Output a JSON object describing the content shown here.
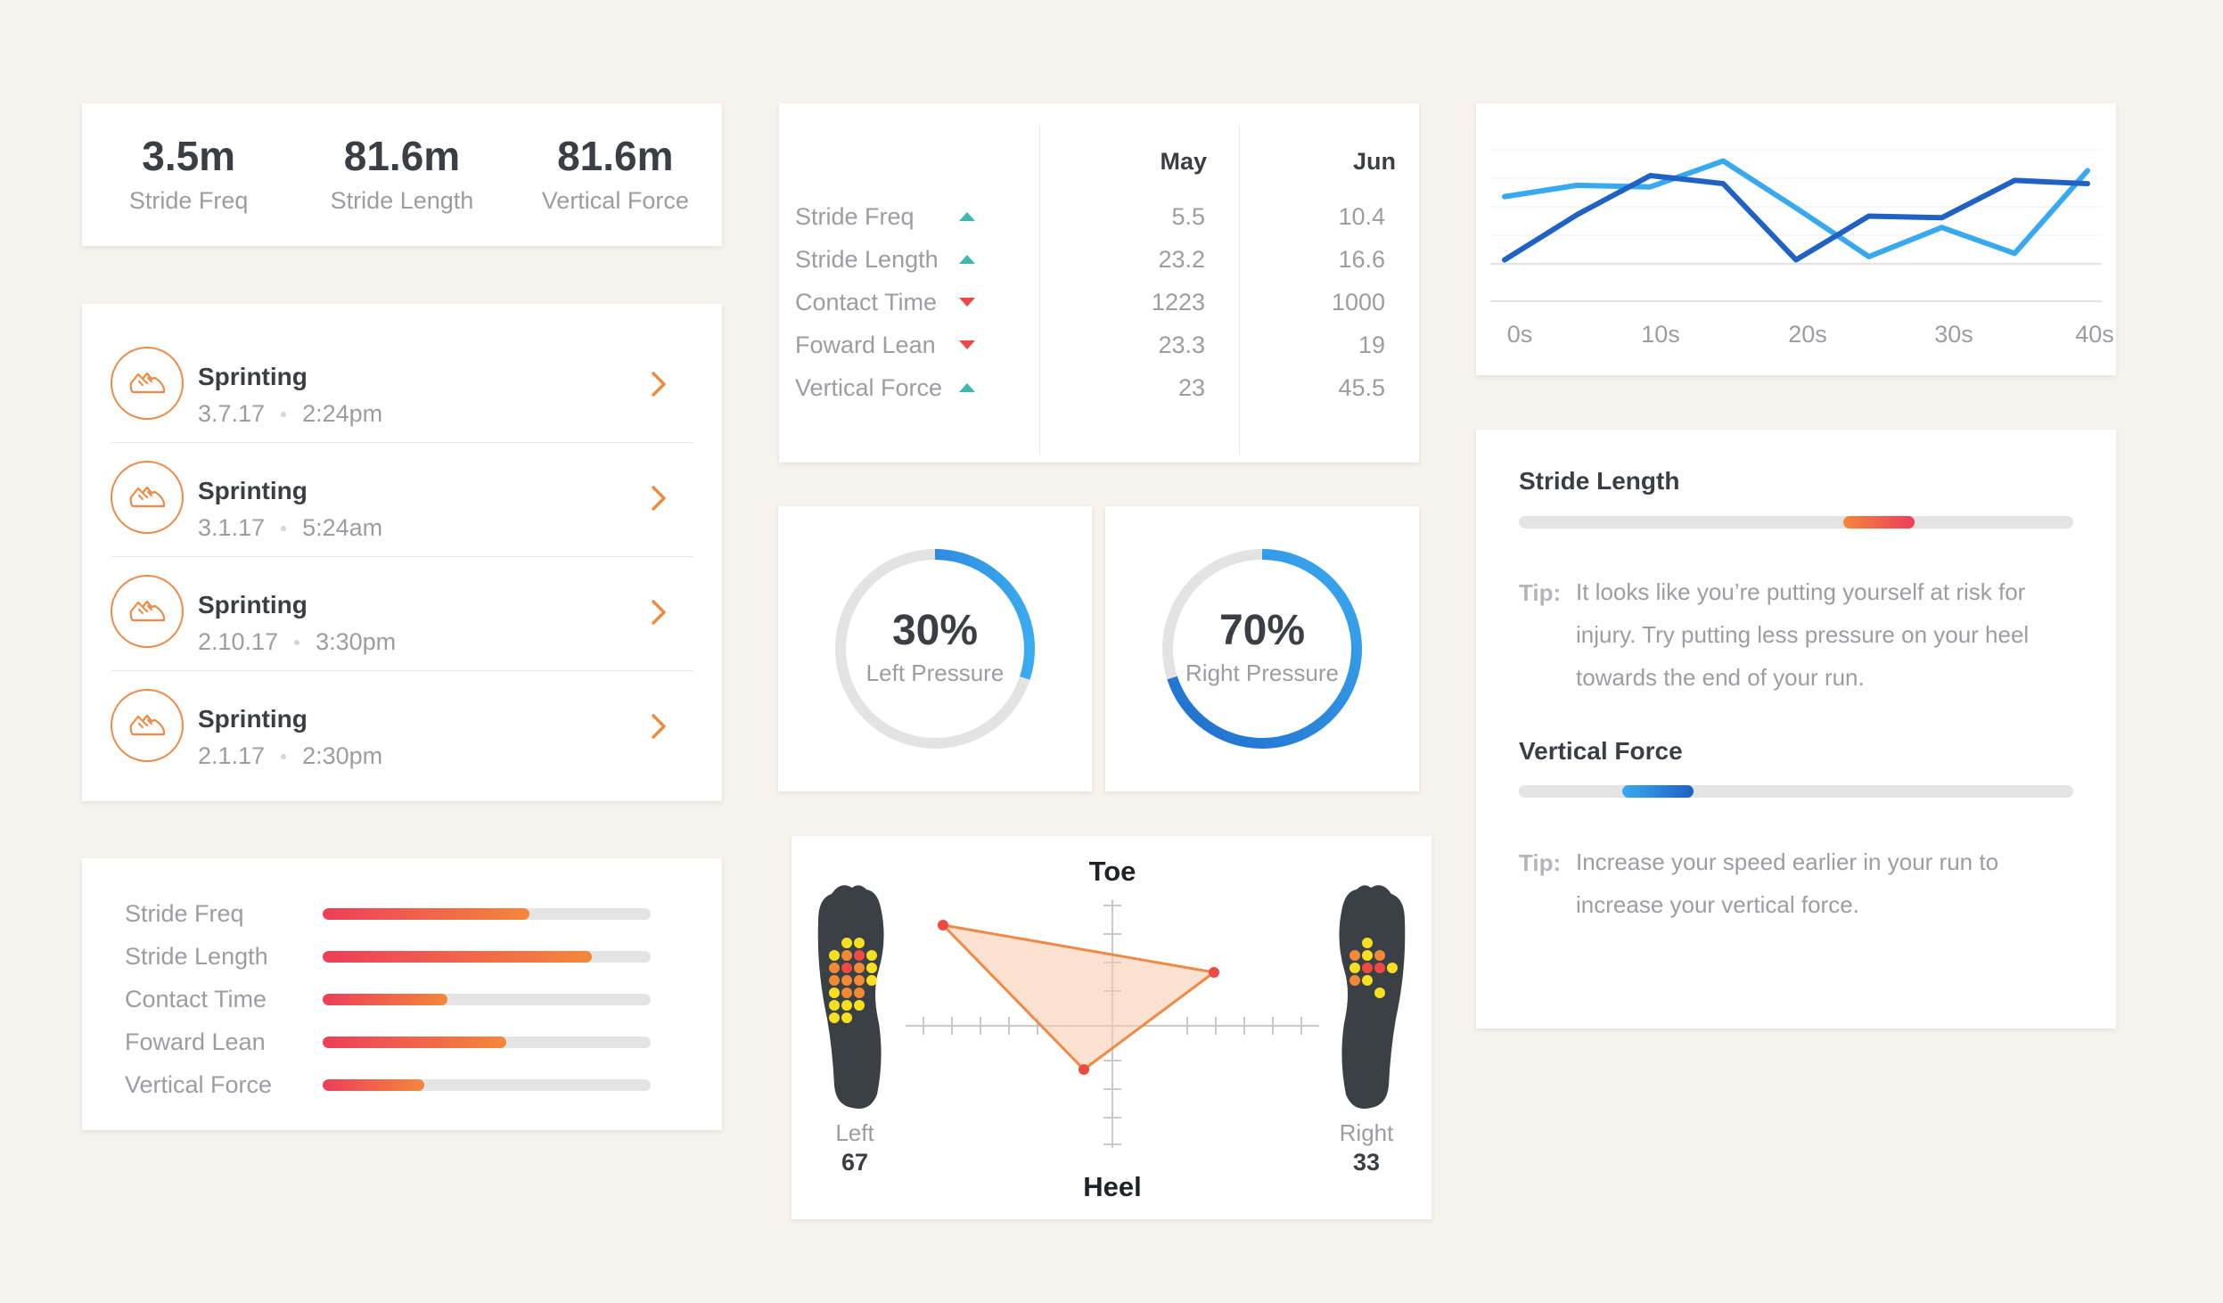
{
  "stats": [
    {
      "value": "3.5m",
      "label": "Stride Freq"
    },
    {
      "value": "81.6m",
      "label": "Stride Length"
    },
    {
      "value": "81.6m",
      "label": "Vertical Force"
    }
  ],
  "sessions": [
    {
      "title": "Sprinting",
      "date": "3.7.17",
      "time": "2:24pm",
      "icon": "running-shoe-icon"
    },
    {
      "title": "Sprinting",
      "date": "3.1.17",
      "time": "5:24am",
      "icon": "running-shoe-icon"
    },
    {
      "title": "Sprinting",
      "date": "2.10.17",
      "time": "3:30pm",
      "icon": "running-shoe-icon"
    },
    {
      "title": "Sprinting",
      "date": "2.1.17",
      "time": "2:30pm",
      "icon": "running-shoe-icon"
    }
  ],
  "bars": [
    {
      "label": "Stride Freq",
      "fraction": 0.63
    },
    {
      "label": "Stride Length",
      "fraction": 0.82
    },
    {
      "label": "Contact Time",
      "fraction": 0.38
    },
    {
      "label": "Foward Lean",
      "fraction": 0.56
    },
    {
      "label": "Vertical Force",
      "fraction": 0.31
    }
  ],
  "table": {
    "columns": [
      "May",
      "Jun"
    ],
    "rows": [
      {
        "label": "Stride Freq",
        "trend": "up",
        "may": "5.5",
        "jun": "10.4"
      },
      {
        "label": "Stride Length",
        "trend": "up",
        "may": "23.2",
        "jun": "16.6"
      },
      {
        "label": "Contact Time",
        "trend": "down",
        "may": "1223",
        "jun": "1000"
      },
      {
        "label": "Foward Lean",
        "trend": "down",
        "may": "23.3",
        "jun": "19"
      },
      {
        "label": "Vertical Force",
        "trend": "up",
        "may": "23",
        "jun": "45.5"
      }
    ]
  },
  "gauges": [
    {
      "percent": "30%",
      "label": "Left Pressure",
      "fraction": 0.3
    },
    {
      "percent": "70%",
      "label": "Right Pressure",
      "fraction": 0.7
    }
  ],
  "footmap": {
    "top_label": "Toe",
    "bottom_label": "Heel",
    "left": {
      "label": "Left",
      "value": "67"
    },
    "right": {
      "label": "Right",
      "value": "33"
    }
  },
  "chart_data": {
    "type": "line",
    "x": [
      0,
      5,
      10,
      15,
      20,
      25,
      30,
      35,
      40
    ],
    "x_ticks": [
      "0s",
      "10s",
      "20s",
      "30s",
      "40s"
    ],
    "series": [
      {
        "color": "#38a8ef",
        "values": [
          5.9,
          6.6,
          6.5,
          8.1,
          5.2,
          2.2,
          4.0,
          2.4,
          7.5
        ]
      },
      {
        "color": "#2062c4",
        "values": [
          2.0,
          4.8,
          7.2,
          6.7,
          2.0,
          4.7,
          4.6,
          6.9,
          6.7
        ]
      }
    ],
    "grid": true,
    "colors": {
      "light": "#38a8ef",
      "dark": "#2062c4"
    }
  },
  "tips": {
    "stride_length": {
      "title": "Stride Length",
      "indicator_fraction": 0.65,
      "tip_label": "Tip:",
      "tip_text": "It looks like you’re putting yourself at risk for injury. Try putting less pressure on your heel towards the end of your run."
    },
    "vertical_force": {
      "title": "Vertical Force",
      "indicator_fraction": 0.25,
      "tip_label": "Tip:",
      "tip_text": "Increase your speed earlier in your run to increase your vertical force."
    }
  },
  "colors": {
    "accent_orange": "#ef8a46",
    "bar_gradient_start": "#ee3d5a",
    "bar_gradient_end": "#f4873c",
    "trend_up": "#3cb8b0",
    "trend_down": "#ee4a42",
    "gauge_blue": "#2a7fd4",
    "background": "#f7f3ef"
  }
}
